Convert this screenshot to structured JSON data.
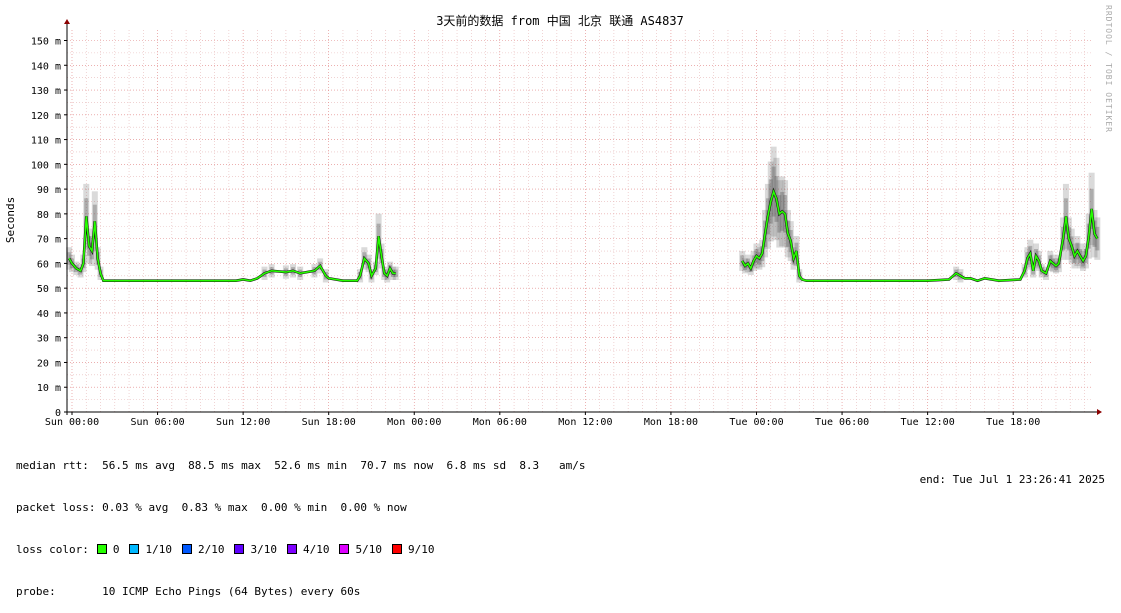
{
  "chart_data": {
    "type": "line",
    "title": "3天前的数据 from 中国 北京 联通 AS4837",
    "ylabel": "Seconds",
    "xlabel": "",
    "ylim": [
      0,
      155
    ],
    "y_ticks": [
      "0",
      "10 m",
      "20 m",
      "30 m",
      "40 m",
      "50 m",
      "60 m",
      "70 m",
      "80 m",
      "90 m",
      "100 m",
      "110 m",
      "120 m",
      "130 m",
      "140 m",
      "150 m"
    ],
    "x_ticks": [
      "Sun 00:00",
      "Sun 06:00",
      "Sun 12:00",
      "Sun 18:00",
      "Mon 00:00",
      "Mon 06:00",
      "Mon 12:00",
      "Mon 18:00",
      "Tue 00:00",
      "Tue 06:00",
      "Tue 12:00",
      "Tue 18:00"
    ],
    "x_range_hours": [
      -0.3,
      72.8
    ],
    "grid": true,
    "series": [
      {
        "segments": [
          [
            [
              -0.2,
              62
            ],
            [
              0,
              60
            ],
            [
              0.3,
              58
            ],
            [
              0.6,
              57
            ],
            [
              0.8,
              60
            ],
            [
              1.0,
              79
            ],
            [
              1.2,
              67
            ],
            [
              1.4,
              65
            ],
            [
              1.6,
              77
            ],
            [
              1.8,
              62
            ],
            [
              2.0,
              56
            ],
            [
              2.2,
              53
            ],
            [
              3,
              53
            ],
            [
              6,
              53
            ],
            [
              9,
              53
            ],
            [
              10.5,
              53
            ],
            [
              11.5,
              53
            ],
            [
              12.0,
              53.5
            ],
            [
              12.5,
              53
            ],
            [
              13,
              54
            ],
            [
              13.5,
              56
            ],
            [
              14,
              57
            ],
            [
              15,
              56.5
            ],
            [
              15.5,
              57
            ],
            [
              16,
              56
            ],
            [
              17,
              57
            ],
            [
              17.4,
              59
            ],
            [
              17.8,
              55
            ],
            [
              18,
              54
            ],
            [
              19,
              53
            ],
            [
              20,
              53
            ],
            [
              20.2,
              55
            ],
            [
              20.5,
              62
            ],
            [
              20.8,
              60
            ],
            [
              21.0,
              55
            ],
            [
              21.3,
              58
            ],
            [
              21.5,
              71
            ],
            [
              21.7,
              63
            ],
            [
              21.9,
              56
            ],
            [
              22.1,
              55
            ],
            [
              22.3,
              58
            ],
            [
              22.5,
              56
            ],
            [
              22.7,
              56
            ]
          ],
          [
            [
              47.0,
              61
            ],
            [
              47.2,
              59
            ],
            [
              47.4,
              60
            ],
            [
              47.6,
              58
            ],
            [
              47.8,
              61
            ],
            [
              48.0,
              63
            ],
            [
              48.2,
              62
            ],
            [
              48.4,
              64
            ],
            [
              48.6,
              72
            ],
            [
              48.8,
              79
            ],
            [
              49.0,
              85
            ],
            [
              49.2,
              89
            ],
            [
              49.4,
              86
            ],
            [
              49.6,
              80
            ],
            [
              49.8,
              81
            ],
            [
              50.0,
              80
            ],
            [
              50.2,
              72
            ],
            [
              50.4,
              69
            ],
            [
              50.6,
              62
            ],
            [
              50.8,
              65
            ],
            [
              51.0,
              55
            ],
            [
              51.2,
              53.5
            ],
            [
              51.5,
              53
            ],
            [
              54,
              53
            ],
            [
              57,
              53
            ],
            [
              60,
              53
            ],
            [
              61.5,
              53.5
            ],
            [
              62,
              56
            ],
            [
              62.3,
              55
            ],
            [
              62.6,
              54
            ],
            [
              63,
              54
            ],
            [
              63.5,
              53
            ],
            [
              64,
              54
            ],
            [
              65,
              53
            ],
            [
              66.5,
              53.5
            ],
            [
              66.8,
              57
            ],
            [
              67.0,
              62
            ],
            [
              67.2,
              64
            ],
            [
              67.4,
              57
            ],
            [
              67.6,
              63
            ],
            [
              67.8,
              61
            ],
            [
              68.0,
              57
            ],
            [
              68.3,
              56
            ],
            [
              68.6,
              61
            ],
            [
              68.8,
              60
            ],
            [
              69.0,
              59
            ],
            [
              69.2,
              60
            ],
            [
              69.5,
              70
            ],
            [
              69.7,
              79
            ],
            [
              69.9,
              70
            ],
            [
              70.1,
              67
            ],
            [
              70.3,
              63
            ],
            [
              70.5,
              65
            ],
            [
              70.7,
              63
            ],
            [
              70.9,
              61
            ],
            [
              71.1,
              63
            ],
            [
              71.3,
              71
            ],
            [
              71.5,
              82
            ],
            [
              71.7,
              72
            ],
            [
              71.9,
              70
            ]
          ]
        ]
      }
    ],
    "stats": {
      "median_rtt": "median rtt:  56.5 ms avg  88.5 ms max  52.6 ms min  70.7 ms now  6.8 ms sd  8.3   am/s",
      "packet_loss": "packet loss: 0.03 % avg  0.83 % max  0.00 % min  0.00 % now",
      "loss_color_label": "loss color:",
      "probe": "probe:       10 ICMP Echo Pings (64 Bytes) every 60s",
      "end": "end: Tue Jul  1 23:26:41 2025"
    },
    "loss_colors": [
      {
        "label": "0",
        "color": "#26ff00"
      },
      {
        "label": "1/10",
        "color": "#00b8ff"
      },
      {
        "label": "2/10",
        "color": "#0059ff"
      },
      {
        "label": "3/10",
        "color": "#5e00ff"
      },
      {
        "label": "4/10",
        "color": "#7e00ff"
      },
      {
        "label": "5/10",
        "color": "#dd00ff"
      },
      {
        "label": "9/10",
        "color": "#ff0000"
      }
    ],
    "watermark": "RRDTOOL / TOBI OETIKER",
    "colors": {
      "line_low_loss": "#26ff00",
      "smoke": "#555555",
      "grid_major": "#e08080",
      "grid_minor": "#e6b8b8",
      "axis": "#000000",
      "arrow": "#8b0000"
    }
  }
}
